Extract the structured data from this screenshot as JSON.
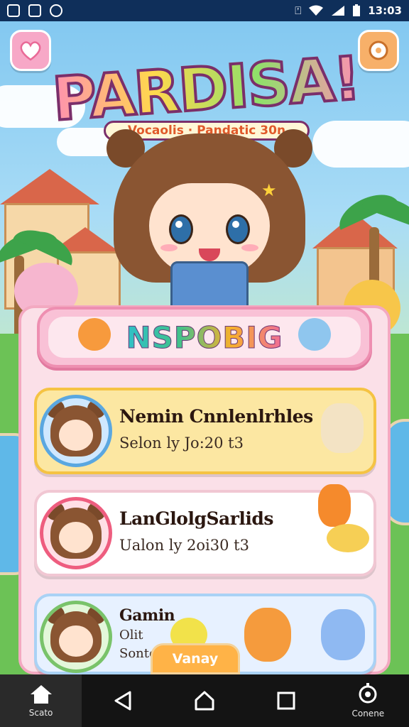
{
  "status_bar": {
    "time": "13:03"
  },
  "header": {
    "logo_title": "PARDISA!",
    "logo_subtitle": "Vocaolis · Pandatic 30n"
  },
  "panel": {
    "title": "NSPOBIG"
  },
  "cards": [
    {
      "title": "Nemin Cnnlenlrhles",
      "subtitle": "Selon ly Jo:20 t3"
    },
    {
      "title": "LanGlolgSarlids",
      "subtitle": "Ualon ly 2oi30 t3"
    },
    {
      "title": "Gamin",
      "subtitle": "Olit",
      "subtitle2": "Sonto"
    }
  ],
  "play_button": {
    "label": "Vanay"
  },
  "navbar": {
    "items": [
      {
        "label": "Scato",
        "icon": "home-icon"
      },
      {
        "label": "",
        "icon": "back-icon"
      },
      {
        "label": "",
        "icon": "home-circle-icon"
      },
      {
        "label": "",
        "icon": "recents-icon"
      },
      {
        "label": "Conene",
        "icon": "settings-icon"
      }
    ]
  },
  "colors": {
    "panel_bg": "#fbe0e8",
    "card1": "#fce7a2",
    "card2": "#ffffff",
    "card3": "#e7f1ff",
    "accent_orange": "#ffb347",
    "status_bar": "#0f2f5a"
  }
}
